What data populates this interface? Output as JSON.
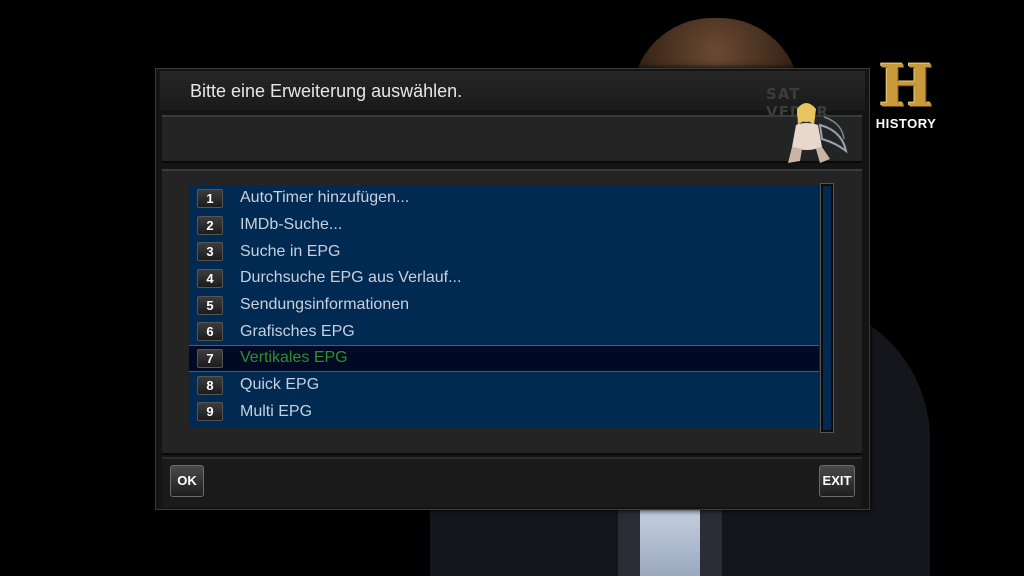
{
  "channel_logo": {
    "letter": "H",
    "name": "HISTORY"
  },
  "dialog": {
    "title": "Bitte eine Erweiterung auswählen.",
    "brand_watermark": "SAT VEDUR"
  },
  "menu": {
    "items": [
      {
        "num": "1",
        "label": "AutoTimer hinzufügen..."
      },
      {
        "num": "2",
        "label": "IMDb-Suche..."
      },
      {
        "num": "3",
        "label": "Suche in EPG"
      },
      {
        "num": "4",
        "label": "Durchsuche EPG aus Verlauf..."
      },
      {
        "num": "5",
        "label": "Sendungsinformationen"
      },
      {
        "num": "6",
        "label": "Grafisches EPG"
      },
      {
        "num": "7",
        "label": "Vertikales EPG"
      },
      {
        "num": "8",
        "label": "Quick EPG"
      },
      {
        "num": "9",
        "label": "Multi EPG"
      }
    ],
    "selected_index": 6
  },
  "buttons": {
    "ok": "OK",
    "exit": "EXIT"
  },
  "colors": {
    "list_background": "#002a52",
    "selected_background": "#000a24",
    "selected_text": "#2e8f2a",
    "logo_gold": "#c89a3a"
  }
}
